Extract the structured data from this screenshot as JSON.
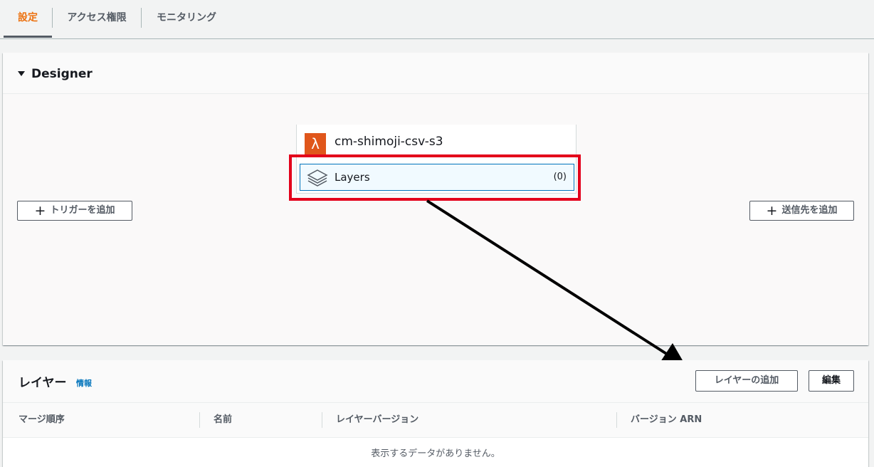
{
  "tabs": [
    {
      "label": "設定",
      "active": true
    },
    {
      "label": "アクセス権限",
      "active": false
    },
    {
      "label": "モニタリング",
      "active": false
    }
  ],
  "designer": {
    "title": "Designer",
    "function_name": "cm-shimoji-csv-s3",
    "function_icon": "lambda-icon",
    "layers_label": "Layers",
    "layers_count": "(0)",
    "add_trigger_label": "トリガーを追加",
    "add_destination_label": "送信先を追加"
  },
  "layers_panel": {
    "title": "レイヤー",
    "info_link": "情報",
    "add_layer_label": "レイヤーの追加",
    "edit_label": "編集",
    "columns": [
      "マージ順序",
      "名前",
      "レイヤーバージョン",
      "バージョン ARN"
    ],
    "empty_message": "表示するデータがありません。"
  },
  "colors": {
    "accent": "#ec7211",
    "link": "#0073bb",
    "highlight_annotation": "#e3001b",
    "lambda_orange": "#e0561b"
  }
}
